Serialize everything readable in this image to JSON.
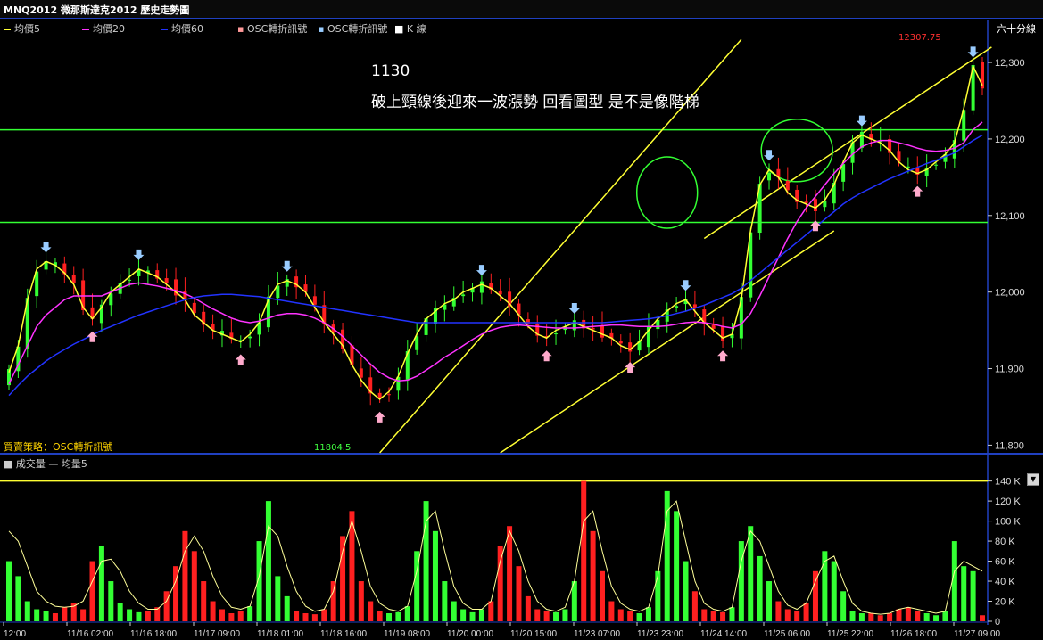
{
  "window_title": "MNQ2012 微那斯達克2012  歷史走勢圖",
  "legend": {
    "ma5": "均價5",
    "ma20": "均價20",
    "ma60": "均價60",
    "osc1": "OSC轉折訊號",
    "osc2": "OSC轉折訊號",
    "kline": "K 線"
  },
  "period_label": "六十分線",
  "note_title": "1130",
  "note_body": "破上頸線後迎來一波漲勢 回看圖型 是不是像階梯",
  "strategy_label": "買賣策略：OSC轉折訊號",
  "volume_legend": "■ 成交量 — 均量5",
  "colors": {
    "ma5": "#ffff33",
    "ma20": "#ff33ff",
    "ma60": "#2233ff",
    "up": "#33ff33",
    "down": "#ff2020",
    "neckline": "#33ff33",
    "channel": "#ffff33",
    "sell_arrow": "#99ccff",
    "buy_arrow": "#ffaacc"
  },
  "chart_data": [
    {
      "type": "line",
      "title": "",
      "price_axis": {
        "ticks": [
          11800,
          11900,
          12000,
          12100,
          12200,
          12300
        ],
        "range": [
          11790,
          12335
        ]
      },
      "neck_lines": [
        12212,
        12091
      ],
      "annotations": {
        "high": "12307.75",
        "low": "11804.5"
      },
      "series": [
        {
          "name": "均價5",
          "values": [
            11895,
            11930,
            11990,
            12030,
            12040,
            12035,
            12025,
            12010,
            11980,
            11965,
            11980,
            12000,
            12010,
            12020,
            12030,
            12025,
            12020,
            12010,
            12000,
            11990,
            11970,
            11960,
            11950,
            11945,
            11940,
            11935,
            11945,
            11960,
            11990,
            12010,
            12015,
            12010,
            12000,
            11980,
            11960,
            11945,
            11930,
            11905,
            11885,
            11870,
            11860,
            11870,
            11890,
            11920,
            11945,
            11965,
            11975,
            11985,
            11990,
            12000,
            12005,
            12010,
            12005,
            11995,
            11985,
            11970,
            11955,
            11945,
            11940,
            11950,
            11955,
            11960,
            11955,
            11950,
            11945,
            11940,
            11930,
            11925,
            11935,
            11950,
            11965,
            11975,
            11985,
            11990,
            11975,
            11960,
            11950,
            11940,
            11945,
            11990,
            12080,
            12140,
            12160,
            12150,
            12130,
            12120,
            12115,
            12110,
            12120,
            12140,
            12170,
            12195,
            12205,
            12200,
            12195,
            12185,
            12170,
            12160,
            12155,
            12160,
            12170,
            12180,
            12195,
            12240,
            12295,
            12270
          ]
        },
        {
          "name": "均價20",
          "values": [
            11880,
            11905,
            11930,
            11955,
            11970,
            11980,
            11990,
            11995,
            11995,
            11995,
            11995,
            12000,
            12005,
            12010,
            12012,
            12010,
            12008,
            12005,
            12002,
            11998,
            11992,
            11985,
            11978,
            11972,
            11966,
            11962,
            11960,
            11962,
            11966,
            11970,
            11972,
            11972,
            11970,
            11966,
            11960,
            11952,
            11942,
            11930,
            11918,
            11906,
            11895,
            11888,
            11884,
            11885,
            11890,
            11898,
            11906,
            11915,
            11922,
            11930,
            11938,
            11945,
            11950,
            11954,
            11956,
            11957,
            11956,
            11955,
            11954,
            11953,
            11953,
            11953,
            11954,
            11955,
            11956,
            11957,
            11957,
            11956,
            11955,
            11955,
            11955,
            11956,
            11958,
            11960,
            11961,
            11960,
            11958,
            11955,
            11953,
            11958,
            11972,
            11995,
            12020,
            12045,
            12070,
            12092,
            12110,
            12125,
            12140,
            12155,
            12168,
            12180,
            12190,
            12195,
            12198,
            12198,
            12195,
            12192,
            12188,
            12185,
            12184,
            12185,
            12188,
            12195,
            12212,
            12222
          ]
        },
        {
          "name": "均價60",
          "values": [
            11865,
            11878,
            11890,
            11900,
            11910,
            11918,
            11925,
            11932,
            11938,
            11944,
            11950,
            11955,
            11960,
            11965,
            11970,
            11974,
            11978,
            11982,
            11986,
            11990,
            11993,
            11995,
            11996,
            11997,
            11997,
            11996,
            11995,
            11994,
            11992,
            11990,
            11988,
            11986,
            11984,
            11982,
            11980,
            11978,
            11976,
            11974,
            11972,
            11970,
            11968,
            11966,
            11964,
            11962,
            11960,
            11960,
            11960,
            11960,
            11960,
            11960,
            11960,
            11960,
            11960,
            11960,
            11960,
            11960,
            11960,
            11960,
            11960,
            11960,
            11960,
            11960,
            11960,
            11960,
            11960,
            11961,
            11962,
            11963,
            11964,
            11965,
            11967,
            11969,
            11972,
            11975,
            11979,
            11983,
            11988,
            11993,
            11998,
            12005,
            12015,
            12025,
            12035,
            12045,
            12055,
            12065,
            12075,
            12085,
            12095,
            12105,
            12115,
            12123,
            12130,
            12136,
            12142,
            12148,
            12153,
            12158,
            12163,
            12168,
            12172,
            12177,
            12182,
            12190,
            12198,
            12205
          ]
        }
      ]
    },
    {
      "type": "bar",
      "title": "",
      "axis_ticks": [
        "0",
        "20 K",
        "40 K",
        "60 K",
        "80 K",
        "100 K",
        "120 K",
        "140 K"
      ],
      "x_ticks": [
        "12:00",
        "11/16 02:00",
        "11/16 18:00",
        "11/17 09:00",
        "11/18 01:00",
        "11/18 16:00",
        "11/19 08:00",
        "11/20 00:00",
        "11/20 15:00",
        "11/23 07:00",
        "11/23 23:00",
        "11/24 14:00",
        "11/25 06:00",
        "11/25 22:00",
        "11/26 18:00",
        "11/27 09:00"
      ],
      "series": [
        {
          "name": "成交量",
          "values": [
            60,
            45,
            20,
            12,
            10,
            8,
            14,
            18,
            12,
            60,
            75,
            40,
            18,
            12,
            9,
            10,
            14,
            30,
            55,
            90,
            70,
            40,
            20,
            12,
            8,
            10,
            15,
            80,
            120,
            45,
            25,
            10,
            8,
            7,
            12,
            40,
            85,
            110,
            40,
            20,
            10,
            8,
            9,
            15,
            70,
            120,
            90,
            40,
            20,
            12,
            9,
            12,
            20,
            75,
            95,
            55,
            25,
            12,
            10,
            9,
            12,
            40,
            140,
            90,
            50,
            20,
            12,
            10,
            8,
            14,
            50,
            130,
            110,
            60,
            30,
            12,
            10,
            9,
            14,
            80,
            95,
            65,
            40,
            20,
            12,
            10,
            18,
            50,
            70,
            60,
            30,
            10,
            8,
            8,
            6,
            8,
            12,
            14,
            10,
            8,
            6,
            10,
            80,
            55,
            50,
            6
          ]
        },
        {
          "name": "均量5",
          "values": [
            90,
            80,
            55,
            30,
            20,
            15,
            14,
            15,
            20,
            40,
            60,
            62,
            50,
            30,
            18,
            12,
            12,
            20,
            40,
            70,
            85,
            70,
            45,
            25,
            14,
            12,
            15,
            45,
            95,
            85,
            55,
            30,
            15,
            10,
            12,
            30,
            70,
            100,
            70,
            35,
            18,
            12,
            10,
            15,
            50,
            100,
            110,
            70,
            35,
            18,
            12,
            12,
            20,
            60,
            90,
            70,
            40,
            20,
            12,
            10,
            14,
            40,
            100,
            110,
            70,
            35,
            18,
            12,
            10,
            14,
            45,
            110,
            120,
            80,
            40,
            18,
            12,
            10,
            14,
            60,
            90,
            80,
            55,
            30,
            16,
            12,
            18,
            40,
            60,
            65,
            40,
            18,
            10,
            8,
            7,
            8,
            12,
            14,
            12,
            10,
            8,
            10,
            50,
            60,
            55,
            50
          ]
        }
      ]
    }
  ]
}
